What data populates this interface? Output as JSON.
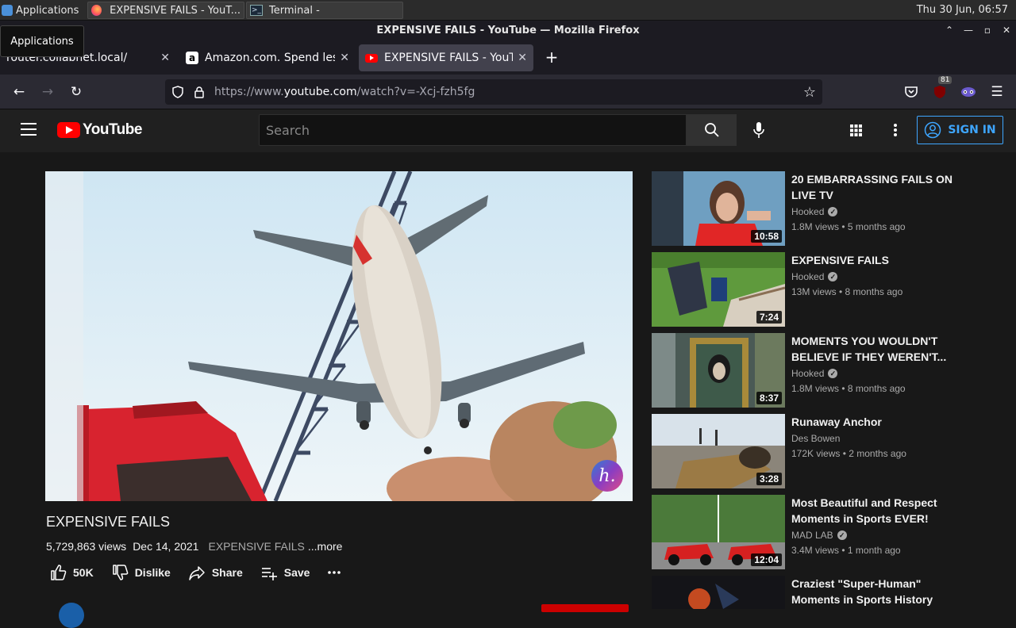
{
  "taskbar": {
    "apps_label": "Applications",
    "tasks": [
      {
        "label": "EXPENSIVE FAILS - YouT..."
      },
      {
        "label": "Terminal -"
      }
    ],
    "clock": "Thu 30 Jun, 06:57",
    "tooltip": "Applications"
  },
  "browser": {
    "window_title": "EXPENSIVE FAILS - YouTube — Mozilla Firefox",
    "tabs": [
      {
        "label": "router.collabnet.local/",
        "active": false
      },
      {
        "label": "Amazon.com. Spend less",
        "active": false
      },
      {
        "label": "EXPENSIVE FAILS - YouTube",
        "active": true
      }
    ],
    "new_tab": "+",
    "url_prefix": "https://www.",
    "url_host": "youtube.com",
    "url_path": "/watch?v=-Xcj-fzh5fg",
    "extension_badge": "81"
  },
  "youtube": {
    "logo_text": "YouTube",
    "search_placeholder": "Search",
    "sign_in": "SIGN IN",
    "video": {
      "title": "EXPENSIVE FAILS",
      "views": "5,729,863 views",
      "date": "Dec 14, 2021",
      "tag": "EXPENSIVE FAILS",
      "more": "...more",
      "likes": "50K",
      "dislike": "Dislike",
      "share": "Share",
      "save": "Save",
      "channel_watermark": "h."
    },
    "recommendations": [
      {
        "title": "20 EMBARRASSING FAILS ON LIVE TV",
        "channel": "Hooked",
        "verified": true,
        "stats": "1.8M views • 5 months ago",
        "duration": "10:58"
      },
      {
        "title": "EXPENSIVE FAILS",
        "channel": "Hooked",
        "verified": true,
        "stats": "13M views • 8 months ago",
        "duration": "7:24"
      },
      {
        "title": "MOMENTS YOU WOULDN'T BELIEVE IF THEY WEREN'T...",
        "channel": "Hooked",
        "verified": true,
        "stats": "1.8M views • 8 months ago",
        "duration": "8:37"
      },
      {
        "title": "Runaway Anchor",
        "channel": "Des Bowen",
        "verified": false,
        "stats": "172K views • 2 months ago",
        "duration": "3:28"
      },
      {
        "title": "Most Beautiful and Respect Moments in Sports EVER!",
        "channel": "MAD LAB",
        "verified": true,
        "stats": "3.4M views • 1 month ago",
        "duration": "12:04"
      },
      {
        "title": "Craziest \"Super-Human\" Moments in Sports History",
        "channel": "",
        "verified": false,
        "stats": "",
        "duration": ""
      }
    ]
  },
  "colors": {
    "accent_blue": "#3ea6ff",
    "yt_red": "#ff0000",
    "page_bg": "#181818"
  }
}
